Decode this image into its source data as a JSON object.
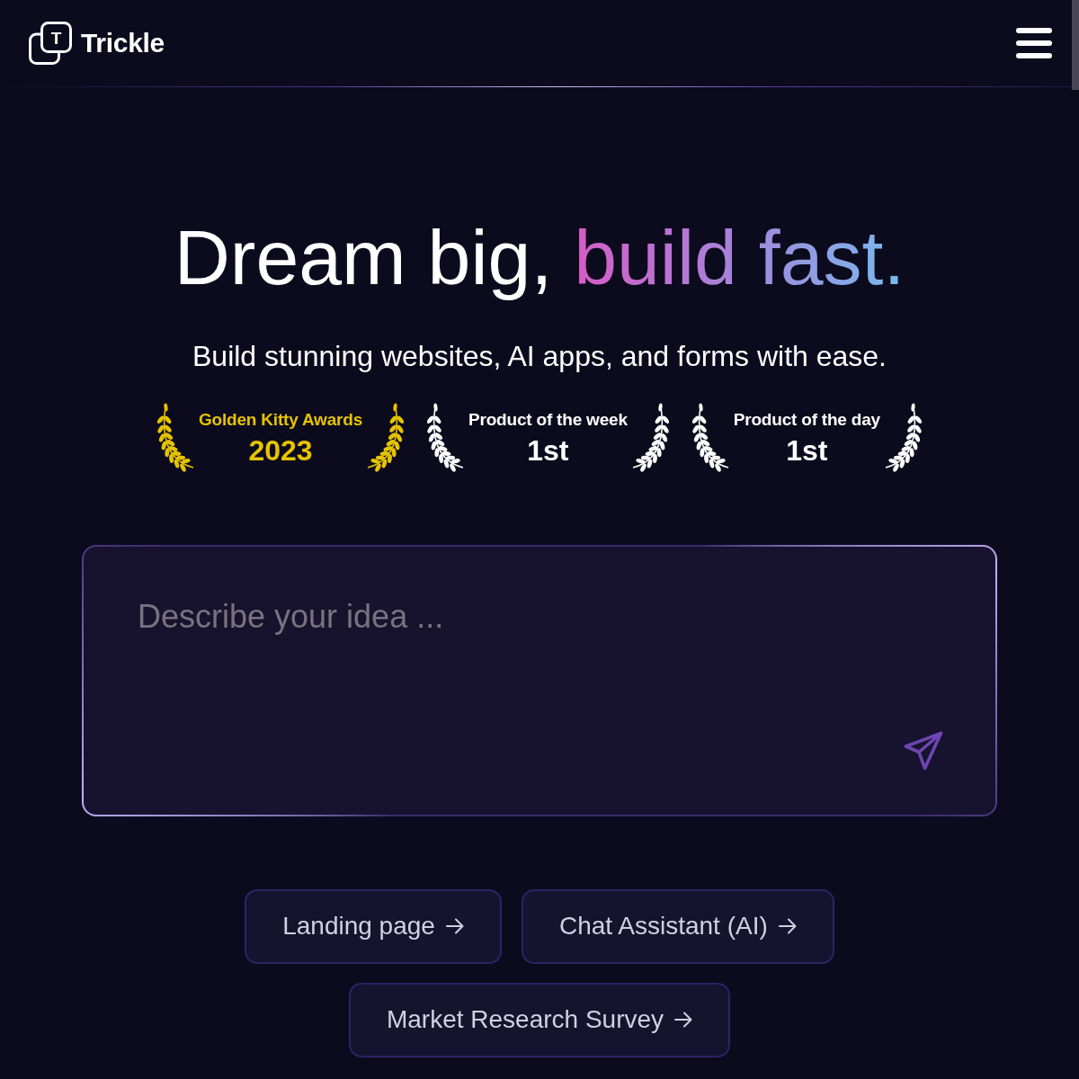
{
  "nav": {
    "logo_letter": "T",
    "brand": "Trickle"
  },
  "hero": {
    "title_plain": "Dream big,",
    "title_highlight": "build fast.",
    "subtitle": "Build stunning websites, AI apps, and forms with ease."
  },
  "awards": [
    {
      "title": "Golden Kitty Awards",
      "rank": "2023",
      "color": "#e6c300"
    },
    {
      "title": "Product of the week",
      "rank": "1st",
      "color": "#ffffff"
    },
    {
      "title": "Product of the day",
      "rank": "1st",
      "color": "#ffffff"
    }
  ],
  "prompt": {
    "placeholder": "Describe your idea ..."
  },
  "templates": [
    {
      "label": "Landing page"
    },
    {
      "label": "Chat Assistant (AI)"
    },
    {
      "label": "Market Research Survey"
    }
  ]
}
